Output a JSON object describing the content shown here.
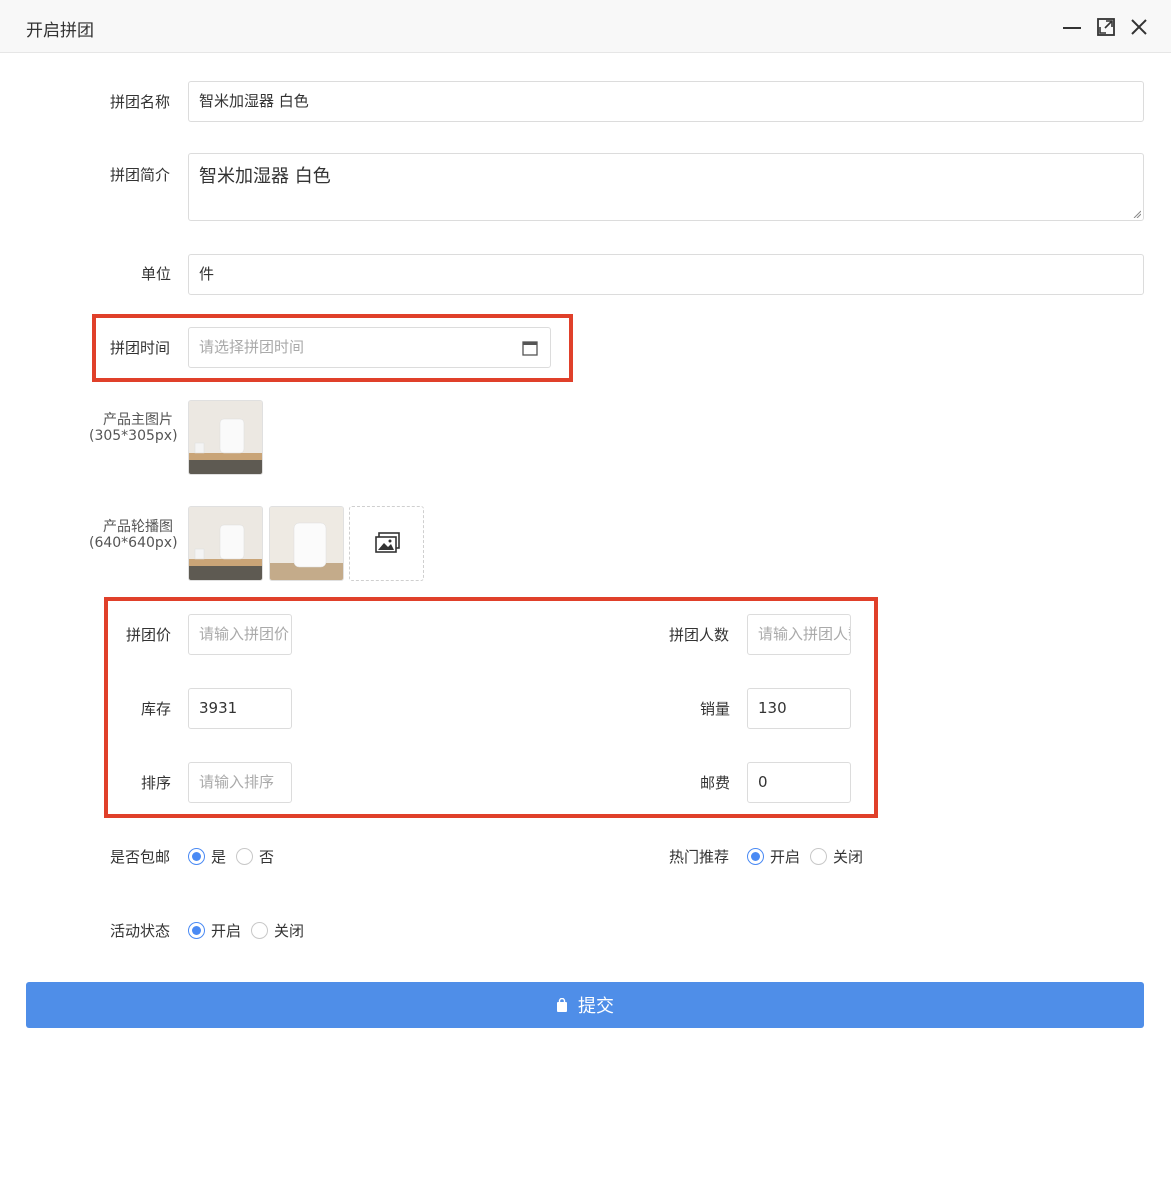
{
  "window": {
    "title": "开启拼团",
    "minimize_icon": "minimize-icon",
    "maximize_icon": "maximize-icon",
    "close_icon": "close-icon"
  },
  "form": {
    "name": {
      "label": "拼团名称",
      "value": "智米加湿器 白色"
    },
    "intro": {
      "label": "拼团简介",
      "value": "智米加湿器 白色"
    },
    "unit": {
      "label": "单位",
      "value": "件"
    },
    "time": {
      "label": "拼团时间",
      "placeholder": "请选择拼团时间",
      "icon": "calendar-icon"
    },
    "main_image": {
      "label_line1": "产品主图片",
      "label_line2": "(305*305px)"
    },
    "carousel": {
      "label_line1": "产品轮播图",
      "label_line2": "(640*640px)",
      "upload_icon": "image-upload-icon"
    },
    "price": {
      "label": "拼团价",
      "placeholder": "请输入拼团价"
    },
    "people": {
      "label": "拼团人数",
      "placeholder": "请输入拼团人数"
    },
    "stock": {
      "label": "库存",
      "value": "3931"
    },
    "sales": {
      "label": "销量",
      "value": "130"
    },
    "sort": {
      "label": "排序",
      "placeholder": "请输入排序"
    },
    "postage": {
      "label": "邮费",
      "value": "0"
    },
    "free_shipping": {
      "label": "是否包邮",
      "options": [
        "是",
        "否"
      ],
      "selected": "是"
    },
    "hot": {
      "label": "热门推荐",
      "options": [
        "开启",
        "关闭"
      ],
      "selected": "开启"
    },
    "status": {
      "label": "活动状态",
      "options": [
        "开启",
        "关闭"
      ],
      "selected": "开启"
    },
    "submit": {
      "label": "提交",
      "icon": "shopping-bag-icon"
    }
  },
  "colors": {
    "accent": "#4f8ee8",
    "highlight": "#e0402a",
    "radio_selected": "#4a8af4"
  }
}
